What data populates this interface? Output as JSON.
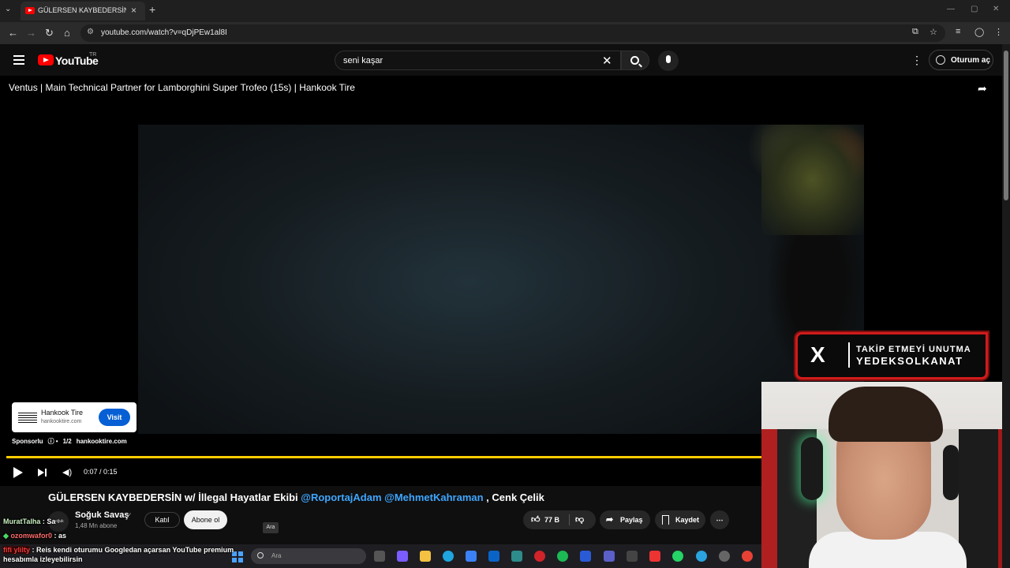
{
  "browser": {
    "tab_title": "GÜLERSEN KAYBEDERSİN w/ İlle",
    "url": "youtube.com/watch?v=qDjPEw1al8I"
  },
  "masthead": {
    "logo_text": "YouTube",
    "country": "TR",
    "search_value": "seni kaşar",
    "signin_label": "Oturum aç"
  },
  "player": {
    "video_title": "Ventus | Main Technical Partner for Lamborghini Super Trofeo (15s) | Hankook Tire",
    "time": "0:07 / 0:15",
    "progress": 0.47,
    "ad": {
      "brand": "Hankook Tire",
      "domain": "hankooktire.com",
      "visit_label": "Visit",
      "sponsored": "Sponsorlu",
      "count": "1/2",
      "info_domain": "hankooktire.com"
    }
  },
  "overlay": {
    "x_logo": "X",
    "line1": "TAKİP ETMEYİ UNUTMA",
    "line2": "YEDEKSOLKANAT"
  },
  "watch": {
    "title_main": "GÜLERSEN KAYBEDERSİN w/ İllegal Hayatlar Ekibi",
    "mention1": "@RoportajAdam",
    "mention2": "@MehmetKahraman",
    "title_tail": ", Cenk Çelik",
    "channel_name": "Soğuk Savaş",
    "channel_avatar_text": "soğuk savaş",
    "subscribers": "1,48 Mn abone",
    "join_label": "Katıl",
    "subscribe_label": "Abone ol",
    "tooltip": "Ara",
    "likes": "77 B",
    "share_label": "Paylaş",
    "save_label": "Kaydet"
  },
  "chat": [
    {
      "user": "MuratTalha",
      "text": ": Sa"
    },
    {
      "user": "ozomwafor0",
      "text": ": as"
    },
    {
      "user": "fifi ylilty",
      "text": ": Reis kendi oturumu Googledan açarsan YouTube premium hesabımla izleyebilirsin"
    }
  ],
  "taskbar": {
    "search_placeholder": "Ara"
  }
}
